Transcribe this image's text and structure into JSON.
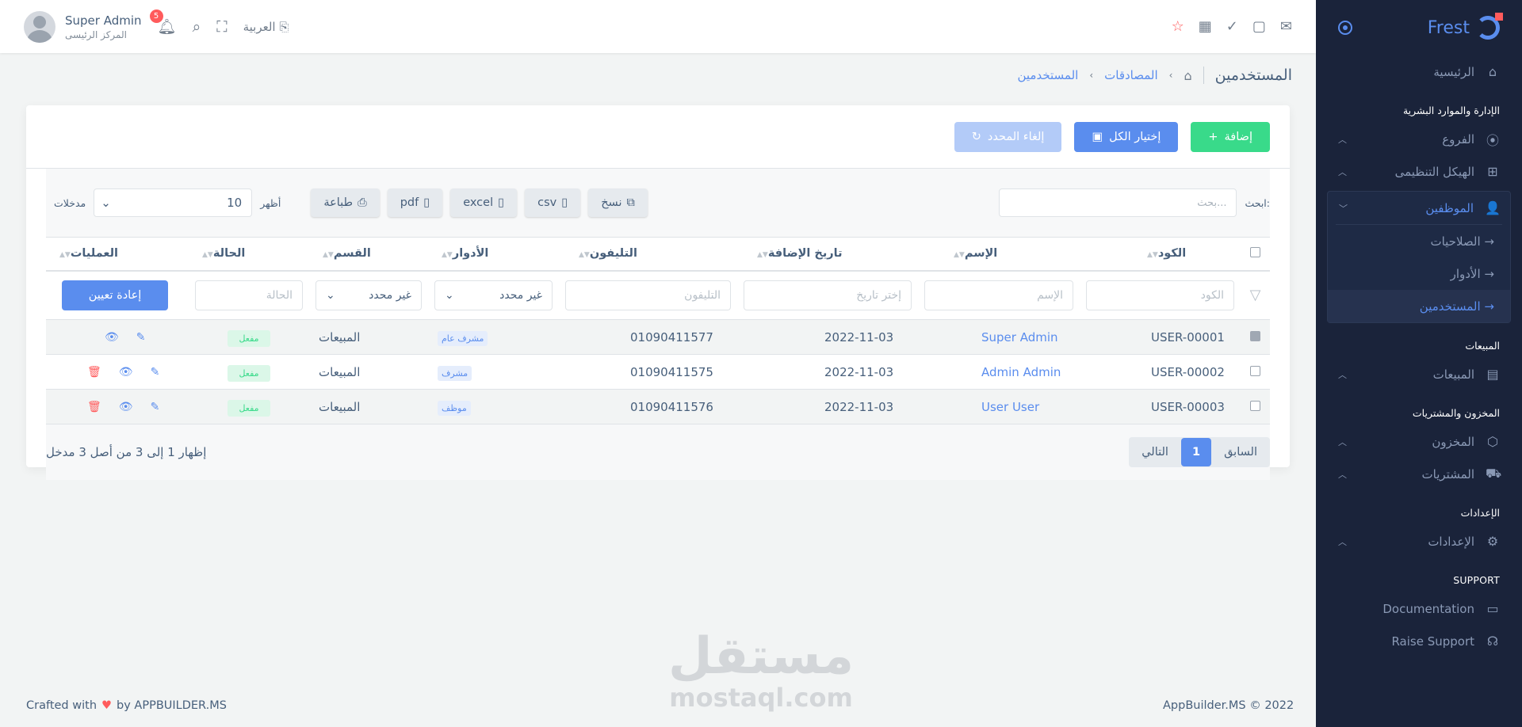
{
  "brand": "Frest",
  "topbar": {
    "user_name": "Super Admin",
    "user_role": "المركز الرئيسى",
    "notifications": "5",
    "language": "العربية"
  },
  "sidebar": {
    "home": "الرئيسية",
    "sec_hr": "الإدارة والموارد البشرية",
    "branches": "الفروع",
    "org": "الهيكل التنظيمى",
    "employees": "الموظفين",
    "permissions": "الصلاحيات",
    "roles": "الأدوار",
    "users": "المستخدمين",
    "sec_sales": "المبيعات",
    "sales": "المبيعات",
    "sec_inventory": "المخزون والمشتريات",
    "inventory": "المخزون",
    "purchases": "المشتريات",
    "sec_settings": "الإعدادات",
    "settings": "الإعدادات",
    "sec_support": "SUPPORT",
    "documentation": "Documentation",
    "raise_support": "Raise Support"
  },
  "breadcrumb": {
    "title": "المستخدمين",
    "auth": "المصادقات",
    "current": "المستخدمين"
  },
  "actions": {
    "add": "إضافة",
    "select_all": "إختيار الكل",
    "deselect": "إلغاء المحدد"
  },
  "toolbar": {
    "search_label": "ابحث:",
    "search_placeholder": "بحث...",
    "copy": "نسخ",
    "csv": "csv",
    "excel": "excel",
    "pdf": "pdf",
    "print": "طباعة",
    "show": "أظهر",
    "entries": "مدخلات",
    "page_length": "10"
  },
  "columns": {
    "code": "الكود",
    "name": "الإسم",
    "date": "تاريخ الإضافة",
    "phone": "التليفون",
    "roles": "الأدوار",
    "department": "القسم",
    "status": "الحالة",
    "operations": "العمليات"
  },
  "filters": {
    "code": "الكود",
    "name": "الإسم",
    "date": "إختر تاريخ",
    "phone": "التليفون",
    "roles": "غير محدد",
    "department": "غير محدد",
    "status": "الحالة",
    "reset": "إعادة تعيين"
  },
  "rows": [
    {
      "code": "USER-00001",
      "name": "Super Admin",
      "date": "2022-11-03",
      "phone": "01090411577",
      "role": "مشرف عام",
      "department": "المبيعات",
      "status": "مفعل"
    },
    {
      "code": "USER-00002",
      "name": "Admin Admin",
      "date": "2022-11-03",
      "phone": "01090411575",
      "role": "مشرف",
      "department": "المبيعات",
      "status": "مفعل"
    },
    {
      "code": "USER-00003",
      "name": "User User",
      "date": "2022-11-03",
      "phone": "01090411576",
      "role": "موظف",
      "department": "المبيعات",
      "status": "مفعل"
    }
  ],
  "pagination": {
    "info": "إظهار 1 إلى 3 من أصل 3 مدخل",
    "prev": "السابق",
    "current": "1",
    "next": "التالي"
  },
  "watermark": {
    "arabic": "مستقل",
    "latin": "mostaql.com"
  },
  "footer": {
    "crafted": "Crafted with",
    "by": "by APPBUILDER.MS",
    "copyright": "AppBuilder.MS © 2022"
  },
  "colors": {
    "primary": "#5a8dee",
    "success": "#39da8a",
    "danger": "#ff5b5c",
    "sidebar": "#1a233a"
  }
}
